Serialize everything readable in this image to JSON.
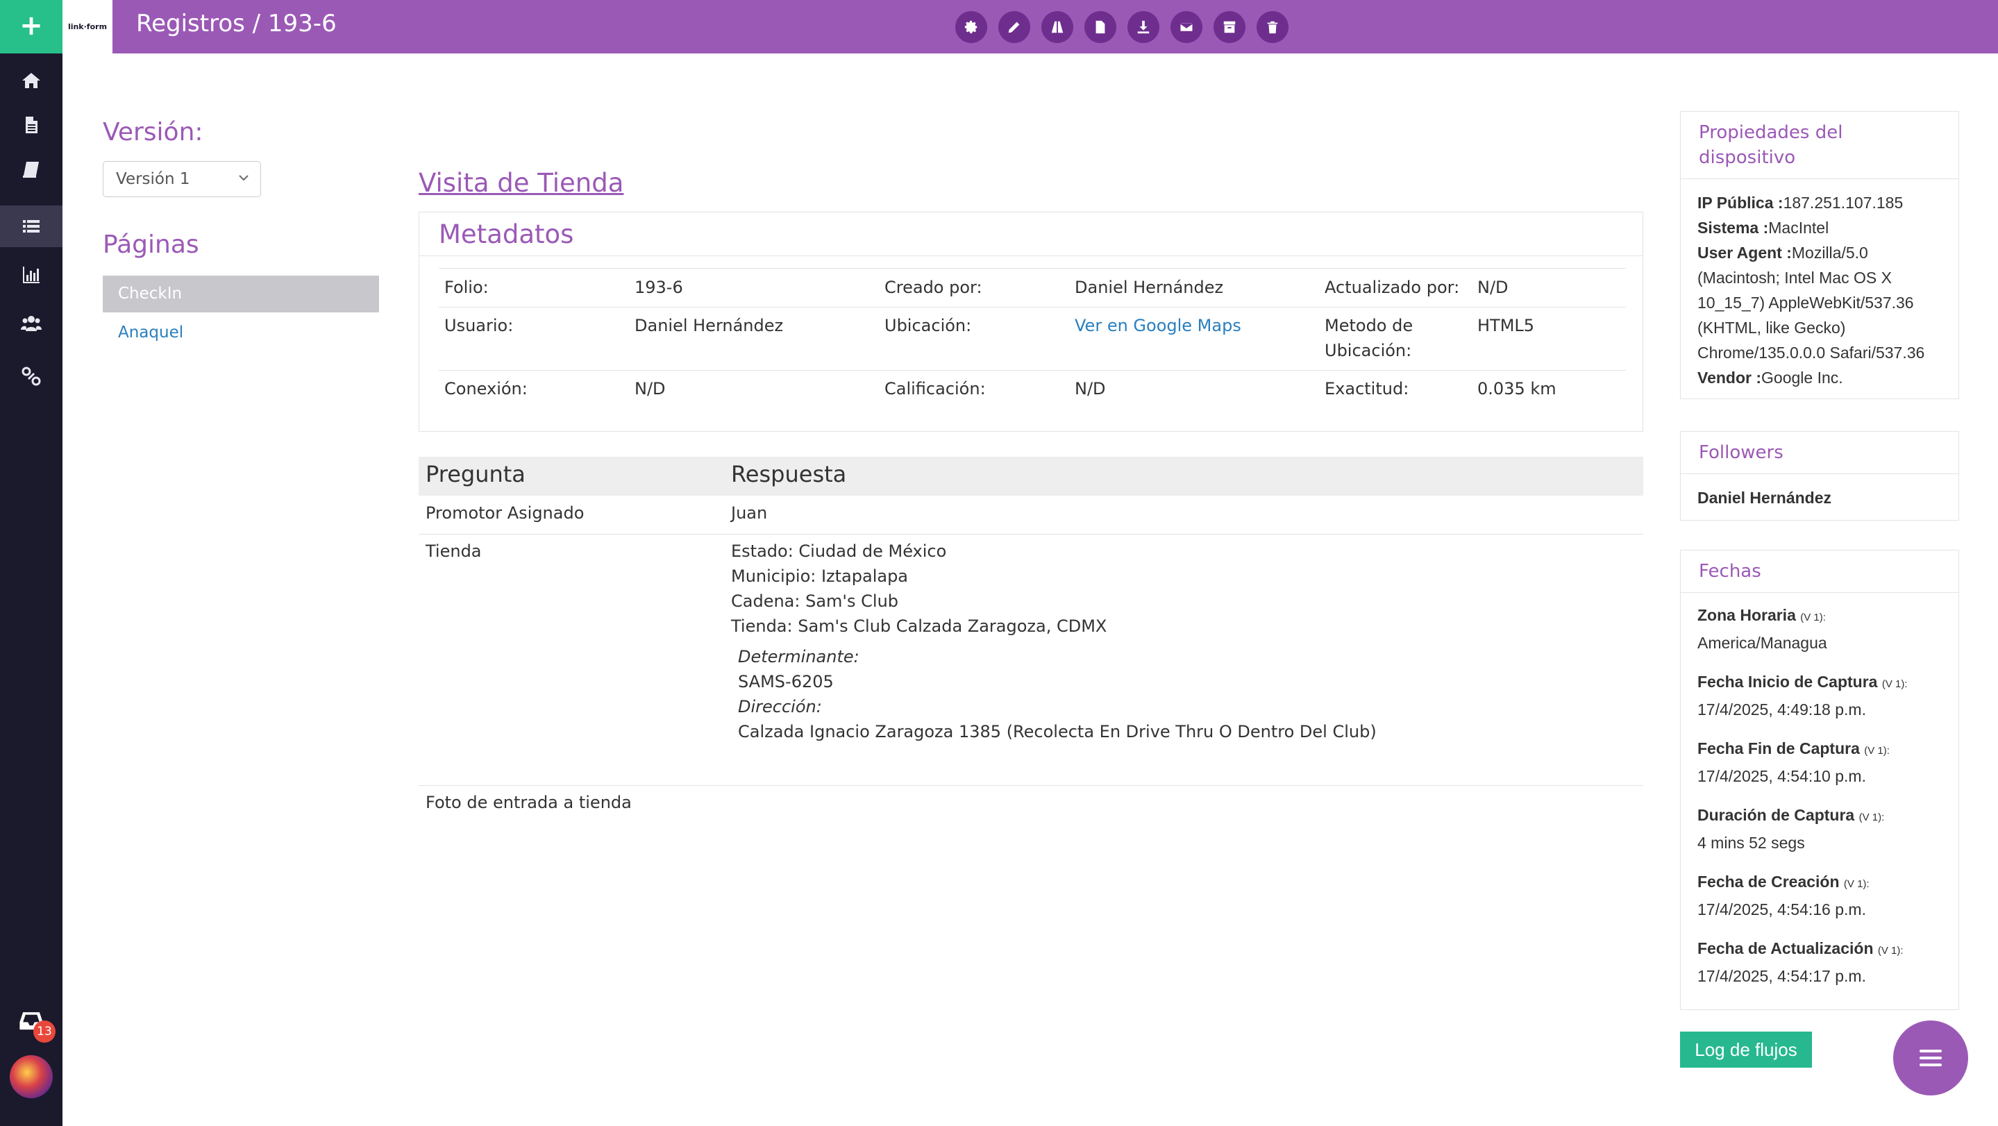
{
  "app": {
    "logo_text": "link·form"
  },
  "header": {
    "title": "Registros / 193-6"
  },
  "sidebar": {
    "add_label": "+",
    "items": [
      {
        "icon": "home-icon"
      },
      {
        "icon": "document-icon"
      },
      {
        "icon": "book-icon"
      },
      {
        "icon": "list-icon"
      },
      {
        "icon": "chart-icon"
      },
      {
        "icon": "users-icon"
      },
      {
        "icon": "link-icon"
      }
    ],
    "inbox_count": "13"
  },
  "toolbar": {
    "buttons": [
      "gear-icon",
      "pencil-icon",
      "road-icon",
      "file-icon",
      "download-icon",
      "envelope-icon",
      "archive-icon",
      "trash-icon"
    ]
  },
  "left": {
    "version_title": "Versión:",
    "version_selected": "Versión 1",
    "pages_title": "Páginas",
    "pages": [
      "CheckIn",
      "Anaquel"
    ]
  },
  "form": {
    "title": "Visita de Tienda"
  },
  "metadata": {
    "title": "Metadatos",
    "folio_label": "Folio:",
    "folio": "193-6",
    "creado_label": "Creado por:",
    "creado": "Daniel Hernández",
    "actualizado_label": "Actualizado por:",
    "actualizado": "N/D",
    "usuario_label": "Usuario:",
    "usuario": "Daniel Hernández",
    "ubicacion_label": "Ubicación:",
    "ubicacion": "Ver en Google Maps",
    "metodo_label_1": "Metodo de",
    "metodo_label_2": "Ubicación:",
    "metodo": "HTML5",
    "conexion_label": "Conexión:",
    "conexion": "N/D",
    "calificacion_label": "Calificación:",
    "calificacion": "N/D",
    "exactitud_label": "Exactitud:",
    "exactitud": "0.035 km"
  },
  "qa": {
    "col_pregunta": "Pregunta",
    "col_respuesta": "Respuesta",
    "promotor_q": "Promotor Asignado",
    "promotor_a": "Juan",
    "tienda_q": "Tienda",
    "tienda_lines": [
      "Estado: Ciudad de México",
      "Municipio: Iztapalapa",
      "Cadena: Sam's Club",
      "Tienda: Sam's Club Calzada Zaragoza, CDMX"
    ],
    "determinante_label": "Determinante:",
    "determinante": "SAMS-6205",
    "direccion_label": "Dirección:",
    "direccion": "Calzada Ignacio Zaragoza 1385 (Recolecta En Drive Thru O Dentro Del Club)",
    "foto_q": "Foto de entrada a tienda"
  },
  "device": {
    "title_1": "Propiedades del",
    "title_2": "dispositivo",
    "ip_label": "IP Pública :",
    "ip": "187.251.107.185",
    "sistema_label": "Sistema :",
    "sistema": "MacIntel",
    "ua_label": "User Agent :",
    "ua_lines": [
      "Mozilla/5.0",
      "(Macintosh; Intel Mac OS X",
      "10_15_7) AppleWebKit/537.36",
      "(KHTML, like Gecko)",
      "Chrome/135.0.0.0 Safari/537.36"
    ],
    "vendor_label": "Vendor :",
    "vendor": "Google Inc."
  },
  "followers": {
    "title": "Followers",
    "items": [
      "Daniel Hernández"
    ]
  },
  "fechas": {
    "title": "Fechas",
    "items": [
      {
        "label": "Zona Horaria",
        "ver": "(V 1):",
        "value": "America/Managua"
      },
      {
        "label": "Fecha Inicio de Captura",
        "ver": "(V 1):",
        "value": "17/4/2025, 4:49:18 p.m."
      },
      {
        "label": "Fecha Fin de Captura",
        "ver": "(V 1):",
        "value": "17/4/2025, 4:54:10 p.m."
      },
      {
        "label": "Duración de Captura",
        "ver": "(V 1):",
        "value": "4 mins 52 segs"
      },
      {
        "label": "Fecha de Creación",
        "ver": "(V 1):",
        "value": "17/4/2025, 4:54:16 p.m."
      },
      {
        "label": "Fecha de Actualización",
        "ver": "(V 1):",
        "value": "17/4/2025, 4:54:17 p.m."
      }
    ]
  },
  "actions": {
    "log_label": "Log de flujos"
  },
  "colors": {
    "brand": "#9b59b6",
    "sidebar": "#1b1a2d",
    "accent_green": "#27c08a",
    "link": "#2a7fbf"
  }
}
